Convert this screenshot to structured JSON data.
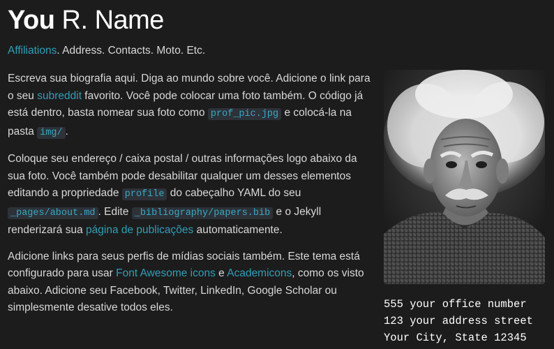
{
  "header": {
    "first_name": "You",
    "rest_name": " R. Name",
    "affiliations_link": "Affiliations",
    "description_rest": ". Address. Contacts. Moto. Etc."
  },
  "bio": {
    "p1": {
      "t1": "Escreva sua biografia aqui. Diga ao mundo sobre você. Adicione o link para o seu ",
      "link": "subreddit",
      "t2": " favorito. Você pode colocar uma foto também. O código já está dentro, basta nomear sua foto como ",
      "code1": "prof_pic.jpg",
      "t3": " e colocá-la na pasta ",
      "code2": "img/",
      "t4": "."
    },
    "p2": {
      "t1": "Coloque seu endereço / caixa postal / outras informações logo abaixo da sua foto. Você também pode desabilitar qualquer um desses elementos editando a propriedade ",
      "code1": "profile",
      "t2": " do cabeçalho YAML do seu ",
      "code2": "_pages/about.md",
      "t3": ". Edite ",
      "code3": "_bibliography/papers.bib",
      "t4": " e o Jekyll renderizará sua ",
      "link": "página de publicações",
      "t5": " automaticamente."
    },
    "p3": {
      "t1": "Adicione links para seus perfis de mídias sociais também. Este tema está configurado para usar ",
      "link1": "Font Awesome icons",
      "t2": " e ",
      "link2": "Academicons",
      "t3": ", como os visto abaixo. Adicione seu Facebook, Twitter, LinkedIn, Google Scholar ou simplesmente desative todos eles."
    }
  },
  "profile": {
    "photo_icon": "profile-photo",
    "address_lines": [
      "555 your office number",
      "123 your address street",
      "Your City, State 12345"
    ]
  },
  "colors": {
    "background": "#1c1c1d",
    "text": "#d8d8d8",
    "link": "#2f9fb5",
    "code_bg": "#2d3138",
    "code_text": "#38a9c4"
  }
}
